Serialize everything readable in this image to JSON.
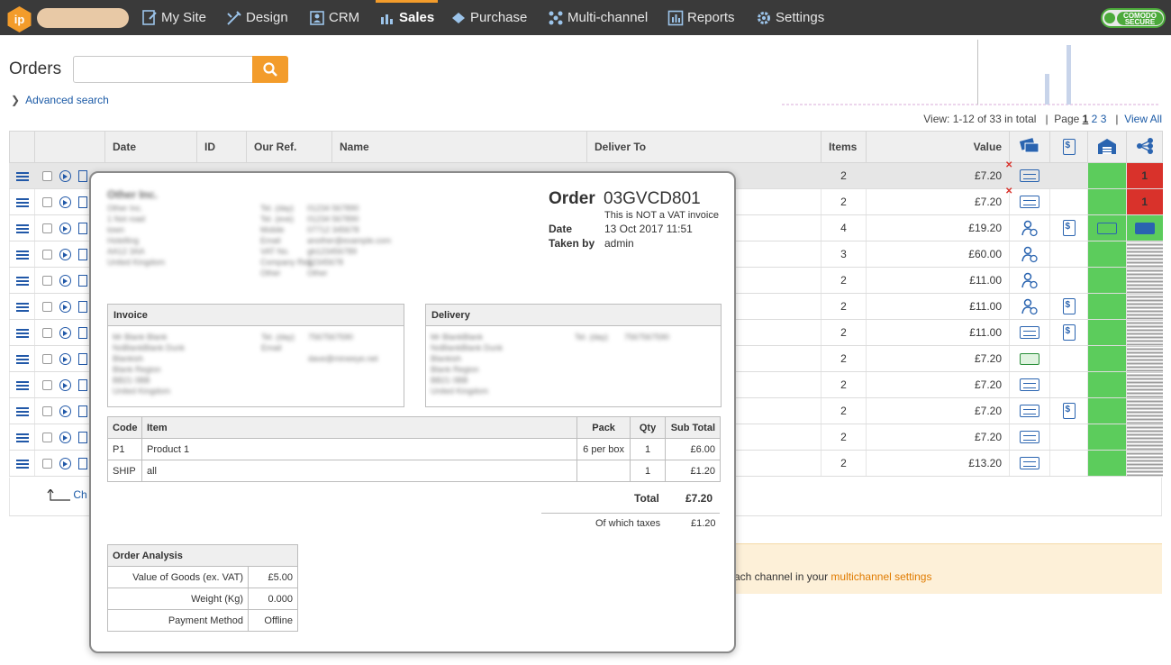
{
  "nav": {
    "logo": "ip",
    "items": [
      {
        "label": "My Site",
        "icon": "my-site-icon"
      },
      {
        "label": "Design",
        "icon": "design-icon"
      },
      {
        "label": "CRM",
        "icon": "crm-icon"
      },
      {
        "label": "Sales",
        "icon": "sales-icon",
        "active": true
      },
      {
        "label": "Purchase",
        "icon": "purchase-icon"
      },
      {
        "label": "Multi-channel",
        "icon": "multichannel-icon"
      },
      {
        "label": "Reports",
        "icon": "reports-icon"
      },
      {
        "label": "Settings",
        "icon": "settings-icon"
      }
    ],
    "badge_line1": "COMODO",
    "badge_line2": "SECURE"
  },
  "page": {
    "title": "Orders",
    "search_placeholder": "",
    "advanced_search": "Advanced search",
    "view_text": "View: 1-12 of 33 in total",
    "page_label": "Page",
    "pages": [
      "1",
      "2",
      "3"
    ],
    "view_all": "View All",
    "change_link": "Ch"
  },
  "table": {
    "headers": [
      "Date",
      "ID",
      "Our Ref.",
      "Name",
      "Deliver To",
      "Items",
      "Value"
    ],
    "rows": [
      {
        "items": "2",
        "value": "£7.20",
        "pay": "card",
        "pay_x": true,
        "invoice": false,
        "ship": "",
        "status": "red",
        "status_text": "1"
      },
      {
        "items": "2",
        "value": "£7.20",
        "pay": "card",
        "pay_x": true,
        "invoice": false,
        "ship": "",
        "status": "red",
        "status_text": "1"
      },
      {
        "items": "4",
        "value": "£19.20",
        "pay": "person",
        "pay_x": false,
        "invoice": true,
        "ship": "truck",
        "status": "green",
        "status_text": ""
      },
      {
        "items": "3",
        "value": "£60.00",
        "pay": "person",
        "pay_x": false,
        "invoice": false,
        "ship": "",
        "status": "grey",
        "status_text": ""
      },
      {
        "items": "2",
        "value": "£11.00",
        "pay": "person",
        "pay_x": false,
        "invoice": false,
        "ship": "",
        "status": "grey",
        "status_text": ""
      },
      {
        "items": "2",
        "value": "£11.00",
        "pay": "person",
        "pay_x": false,
        "invoice": true,
        "ship": "",
        "status": "grey",
        "status_text": ""
      },
      {
        "items": "2",
        "value": "£11.00",
        "pay": "card",
        "pay_x": false,
        "invoice": true,
        "ship": "",
        "status": "grey",
        "status_text": ""
      },
      {
        "items": "2",
        "value": "£7.20",
        "pay": "cash",
        "pay_x": false,
        "invoice": false,
        "ship": "",
        "status": "grey",
        "status_text": ""
      },
      {
        "items": "2",
        "value": "£7.20",
        "pay": "card",
        "pay_x": false,
        "invoice": false,
        "ship": "",
        "status": "grey",
        "status_text": ""
      },
      {
        "items": "2",
        "value": "£7.20",
        "pay": "card",
        "pay_x": false,
        "invoice": true,
        "ship": "",
        "status": "grey",
        "status_text": ""
      },
      {
        "items": "2",
        "value": "£7.20",
        "pay": "card",
        "pay_x": false,
        "invoice": false,
        "ship": "",
        "status": "grey",
        "status_text": ""
      },
      {
        "items": "2",
        "value": "£13.20",
        "pay": "card",
        "pay_x": false,
        "invoice": false,
        "ship": "",
        "status": "grey",
        "status_text": ""
      }
    ]
  },
  "notice": {
    "text": "ach channel in your ",
    "link": "multichannel settings"
  },
  "popup": {
    "company": "Other Inc.",
    "order_label": "Order",
    "order_no": "03GVCD801",
    "vat_note": "This is NOT a VAT invoice",
    "date_label": "Date",
    "date_value": "13 Oct 2017 11:51",
    "taken_label": "Taken by",
    "taken_value": "admin",
    "invoice_title": "Invoice",
    "delivery_title": "Delivery",
    "items_headers": [
      "Code",
      "Item",
      "Pack",
      "Qty",
      "Sub Total"
    ],
    "items": [
      {
        "code": "P1",
        "item": "Product 1",
        "pack": "6 per box",
        "qty": "1",
        "sub": "£6.00"
      },
      {
        "code": "SHIP",
        "item": "all",
        "pack": "",
        "qty": "1",
        "sub": "£1.20"
      }
    ],
    "total_label": "Total",
    "total_value": "£7.20",
    "taxes_label": "Of which taxes",
    "taxes_value": "£1.20",
    "analysis_title": "Order Analysis",
    "analysis": [
      {
        "k": "Value of Goods (ex. VAT)",
        "v": "£5.00"
      },
      {
        "k": "Weight (Kg)",
        "v": "0.000"
      },
      {
        "k": "Payment Method",
        "v": "Offline"
      }
    ],
    "blurred_address": [
      "Other Inc.",
      "1 Not road",
      "town",
      "Hotelling",
      "AA12 3AA",
      "United Kingdom"
    ],
    "blurred_contact": [
      "Tel. (day)",
      "Tel. (eve)",
      "Mobile",
      "Email",
      "VAT No.",
      "Company Reg.",
      "Other"
    ],
    "blurred_contact_vals": [
      "01234 567890",
      "01234 567890",
      "07712 345678",
      "another@example.com",
      "gb123456789",
      "12345678",
      "Other"
    ],
    "blurred_invoice": [
      "Mr Blank Blank",
      "NoBlankBlank Dunk",
      "Blankish",
      "Blank Region",
      "BB21 0BB",
      "United Kingdom"
    ],
    "blurred_invoice_contact": [
      "Tel. (day)",
      "Email"
    ],
    "blurred_invoice_vals": [
      "7567567590",
      "dave@mineeye.net"
    ],
    "blurred_delivery": [
      "Mr BlankBlank",
      "NoBlankBlank Dunk",
      "Blankish",
      "Blank Region",
      "BB21 0BB",
      "United Kingdom"
    ],
    "blurred_delivery_contact": [
      "Tel. (day)"
    ],
    "blurred_delivery_vals": [
      "7567567590"
    ]
  }
}
